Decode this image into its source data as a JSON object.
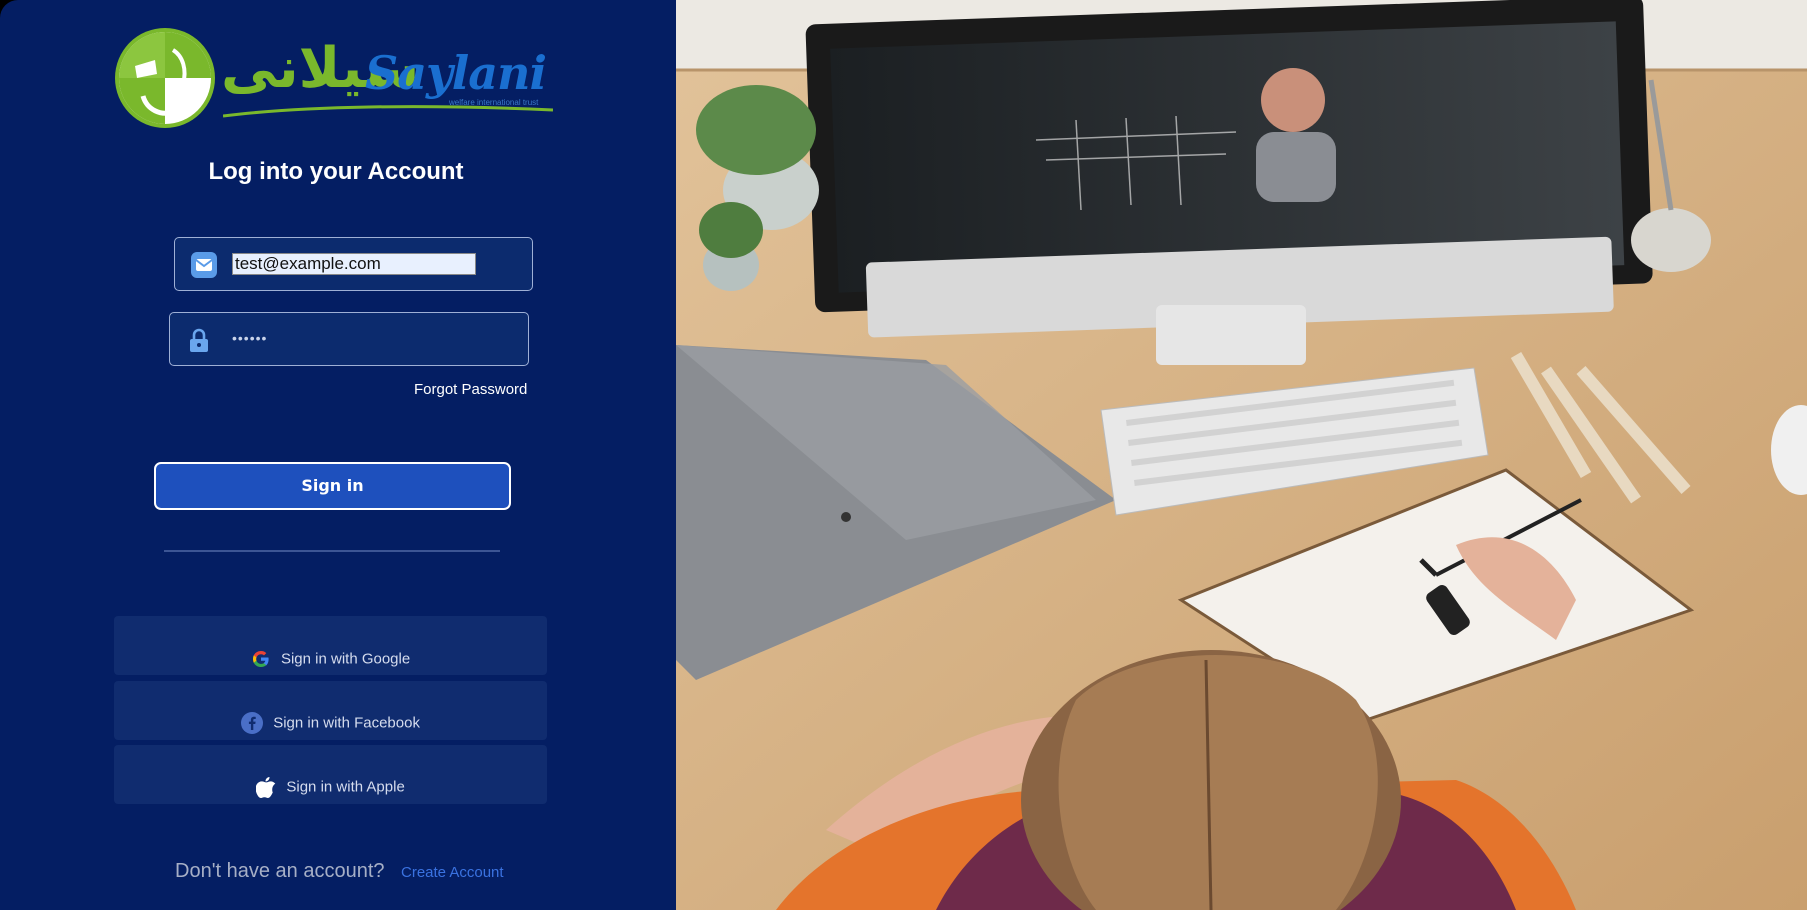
{
  "logo": {
    "urdu_text": "سیلانی",
    "brand_name": "Saylani",
    "tagline": "welfare international trust",
    "colors": {
      "green": "#7ab82c",
      "blue": "#1a6fd0"
    }
  },
  "form": {
    "title": "Log into your Account",
    "email_value": "test@example.com",
    "password_mask": "••••••",
    "forgot_label": "Forgot Password",
    "signin_label": "Sign in"
  },
  "social": {
    "google_label": "Sign in with Google",
    "facebook_label": "Sign in with Facebook",
    "apple_label": "Sign in with Apple"
  },
  "footer": {
    "no_account_text": "Don't have an account?",
    "create_label": "Create Account"
  },
  "colors": {
    "panel_bg": "#041e63",
    "button_bg": "#1e50bd",
    "link": "#3a72e0"
  },
  "icons": [
    "logo-emblem-icon",
    "mail-icon",
    "lock-icon",
    "google-icon",
    "facebook-icon",
    "apple-icon"
  ]
}
